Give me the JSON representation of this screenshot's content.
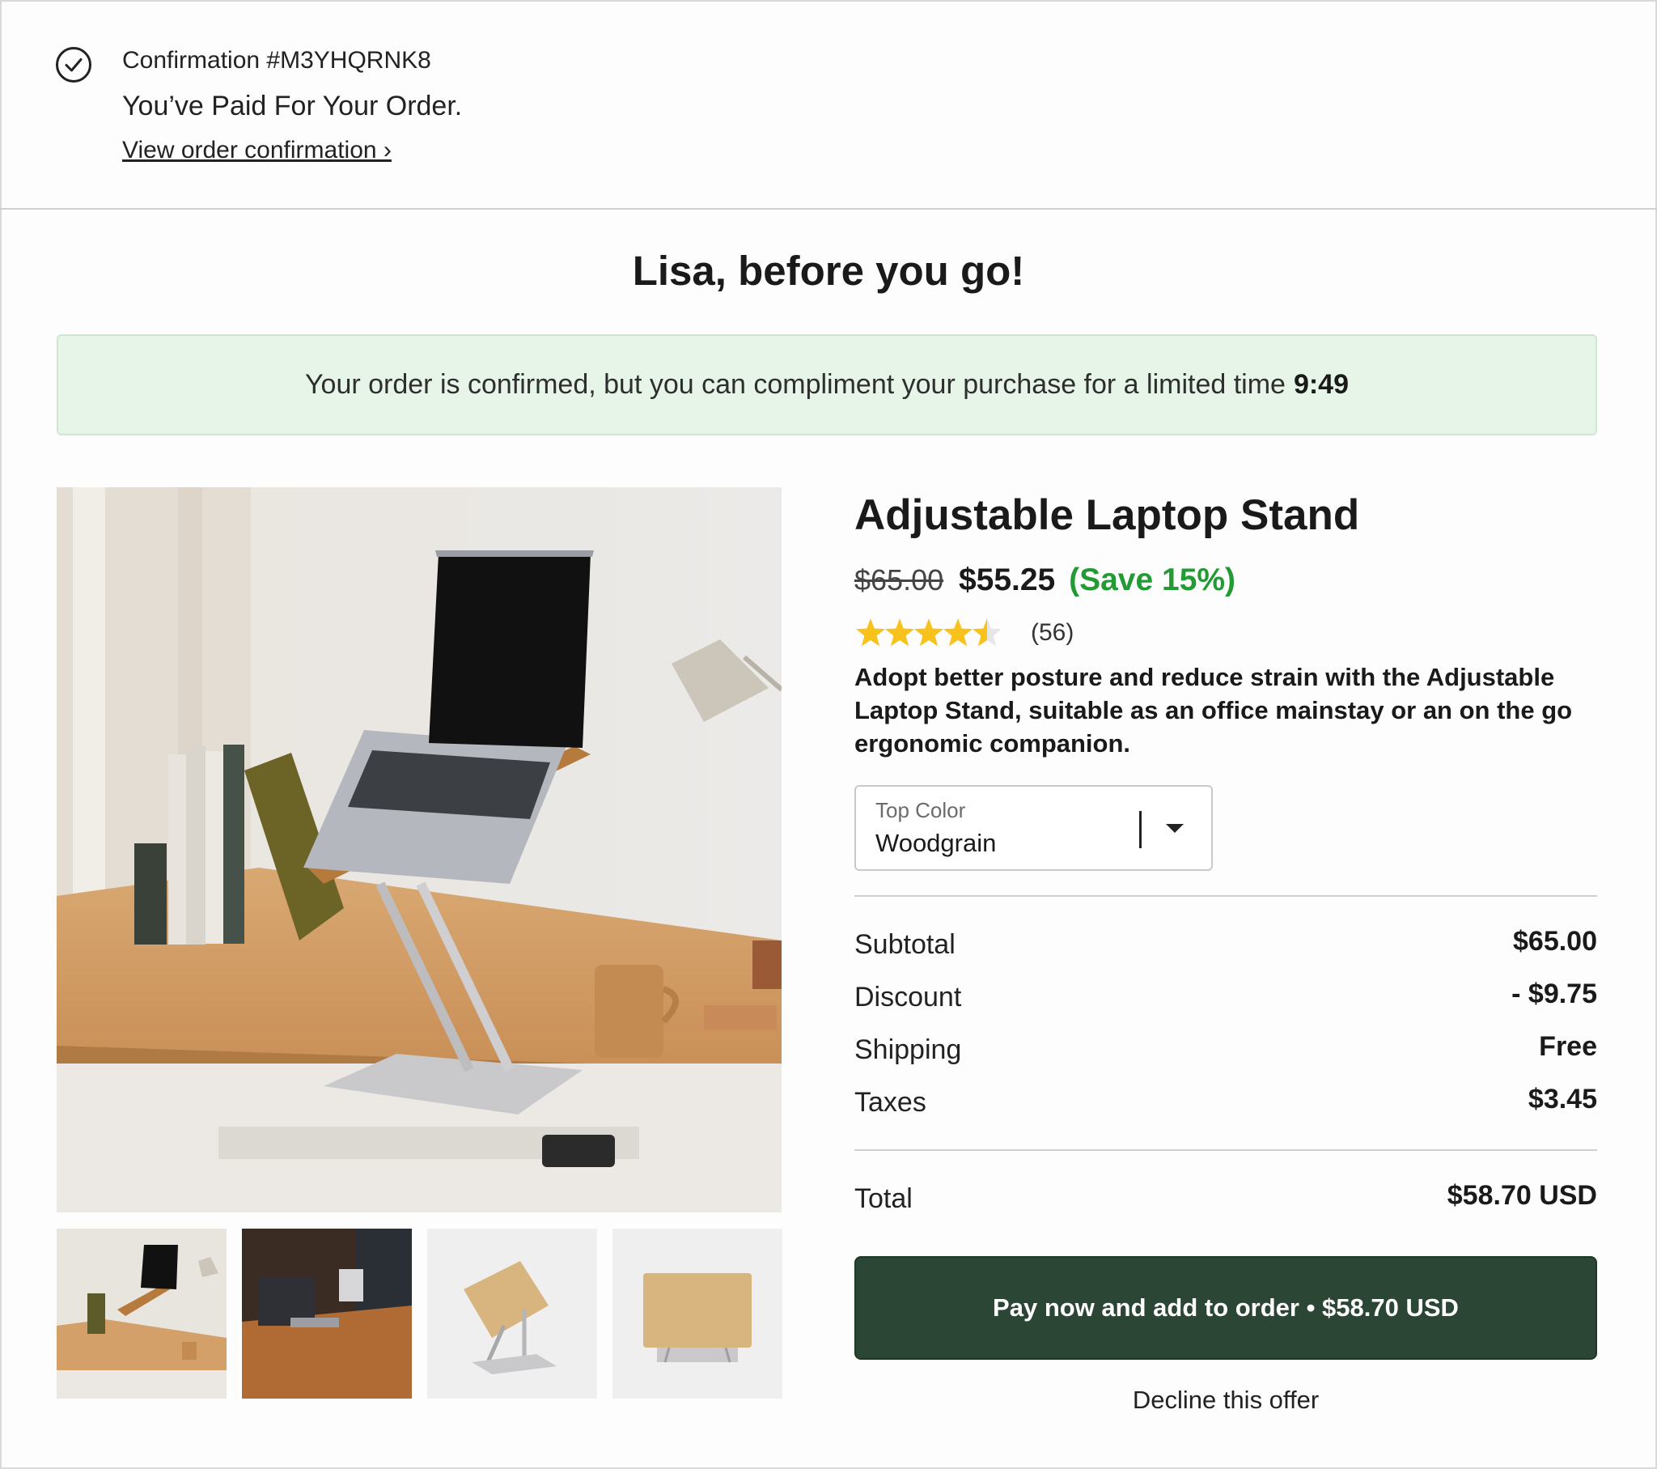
{
  "header": {
    "confirmation": "Confirmation #M3YHQRNK8",
    "paid_message": "You’ve Paid For Your Order.",
    "view_link": "View order confirmation ›"
  },
  "greeting": "Lisa, before you go!",
  "timer_banner": {
    "message": "Your order is confirmed, but you can compliment your purchase for a limited time",
    "time": "9:49"
  },
  "product": {
    "title": "Adjustable Laptop Stand",
    "original_price": "$65.00",
    "sale_price": "$55.25",
    "save_text": "(Save 15%)",
    "rating": 4.5,
    "rating_max": 5,
    "review_count": "(56)",
    "description": "Adopt better posture and reduce strain with the Adjustable Laptop Stand, suitable as an office mainstay or an on the go ergonomic companion.",
    "variant": {
      "label": "Top Color",
      "value": "Woodgrain"
    }
  },
  "summary": {
    "subtotal_label": "Subtotal",
    "subtotal_value": "$65.00",
    "discount_label": "Discount",
    "discount_value": "- $9.75",
    "shipping_label": "Shipping",
    "shipping_value": "Free",
    "taxes_label": "Taxes",
    "taxes_value": "$3.45",
    "total_label": "Total",
    "total_value": "$58.70 USD"
  },
  "actions": {
    "pay_button": "Pay now and add to order • $58.70 USD",
    "decline": "Decline this offer"
  },
  "colors": {
    "save_green": "#239b34",
    "button_bg": "#2c4636",
    "banner_bg": "#e6f5e8",
    "star": "#f7c21c"
  },
  "icons": {
    "confirmation": "check-circle-icon",
    "dropdown": "caret-down-icon",
    "rating": "star-icon"
  }
}
